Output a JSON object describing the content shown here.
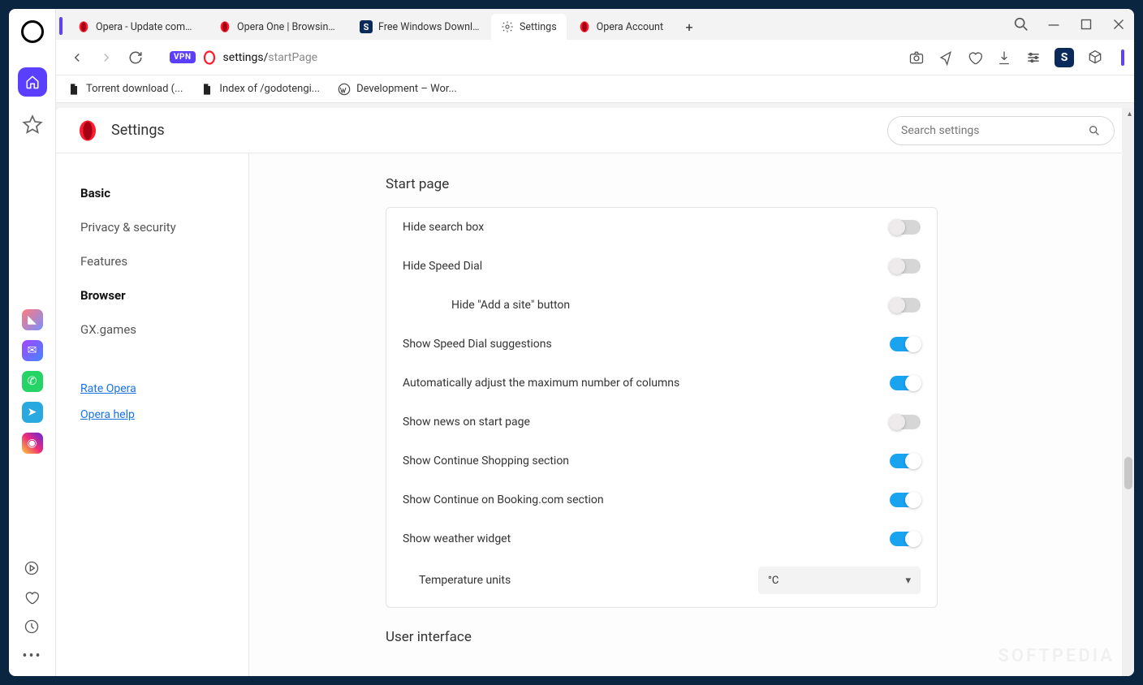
{
  "tabs": [
    {
      "label": "Opera - Update complete!",
      "icon": "opera-red"
    },
    {
      "label": "Opera One | Browsing rein",
      "icon": "opera-red"
    },
    {
      "label": "Free Windows Downloads",
      "icon": "softpedia"
    },
    {
      "label": "Settings",
      "icon": "gear",
      "active": true
    },
    {
      "label": "Opera Account",
      "icon": "opera-red"
    }
  ],
  "addressBar": {
    "vpn": "VPN",
    "url_host": "settings/",
    "url_path": "startPage"
  },
  "bookmarks": [
    {
      "label": "Torrent download (...",
      "icon": "file"
    },
    {
      "label": "Index of /godotengi...",
      "icon": "file"
    },
    {
      "label": "Development – Wor...",
      "icon": "wp"
    }
  ],
  "page": {
    "title": "Settings",
    "searchPlaceholder": "Search settings"
  },
  "nav": {
    "items": [
      {
        "label": "Basic",
        "active": true
      },
      {
        "label": "Privacy & security"
      },
      {
        "label": "Features"
      },
      {
        "label": "Browser",
        "active": true
      },
      {
        "label": "GX.games"
      }
    ],
    "links": [
      {
        "label": "Rate Opera"
      },
      {
        "label": "Opera help"
      }
    ]
  },
  "content": {
    "sectionTitle": "Start page",
    "rows": [
      {
        "label": "Hide search box",
        "on": false
      },
      {
        "label": "Hide Speed Dial",
        "on": false
      },
      {
        "label": "Hide \"Add a site\" button",
        "on": false,
        "indent": true
      },
      {
        "label": "Show Speed Dial suggestions",
        "on": true
      },
      {
        "label": "Automatically adjust the maximum number of columns",
        "on": true
      },
      {
        "label": "Show news on start page",
        "on": false
      },
      {
        "label": "Show Continue Shopping section",
        "on": true
      },
      {
        "label": "Show Continue on Booking.com section",
        "on": true
      },
      {
        "label": "Show weather widget",
        "on": true
      }
    ],
    "tempUnits": {
      "label": "Temperature units",
      "value": "°C"
    },
    "nextSection": "User interface"
  },
  "railApps": [
    {
      "name": "launcher",
      "bg": "linear-gradient(135deg,#ff7a7a,#7a8fff)",
      "glyph": "◣"
    },
    {
      "name": "messenger",
      "bg": "linear-gradient(135deg,#a543ff,#4388ff)",
      "glyph": "✉"
    },
    {
      "name": "whatsapp",
      "bg": "#25d366",
      "glyph": "✆"
    },
    {
      "name": "telegram",
      "bg": "#2aa9e0",
      "glyph": "➤"
    },
    {
      "name": "instagram",
      "bg": "linear-gradient(45deg,#f9ce34,#ee2a7b,#6228d7)",
      "glyph": "◉"
    }
  ],
  "watermark": "SOFTPEDIA"
}
